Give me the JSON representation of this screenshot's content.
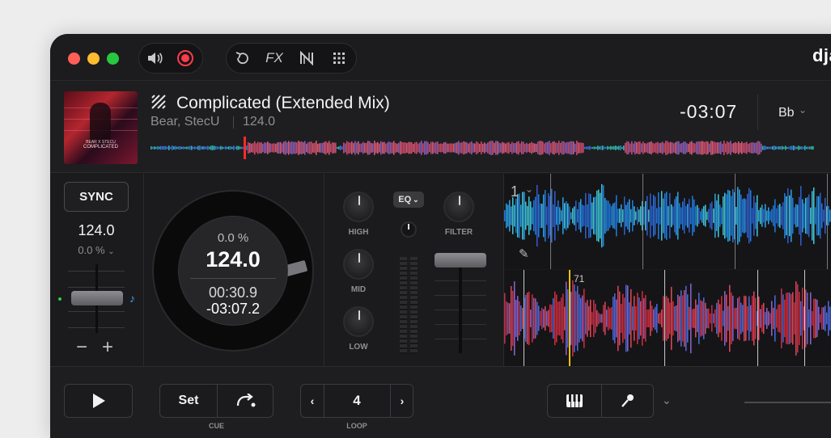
{
  "window": {
    "brand": "djay"
  },
  "titlebar": {
    "traffic_lights": [
      "#fe5f57",
      "#febc2e",
      "#28c840"
    ],
    "icons": [
      "speaker-icon",
      "record-icon",
      "loop-icon",
      "fx-icon",
      "neural-mix-icon",
      "grid-icon"
    ],
    "fx_label": "FX",
    "record_color": "#ff3b4a"
  },
  "track": {
    "title": "Complicated (Extended Mix)",
    "artist": "Bear, StecU",
    "bpm": "124.0",
    "remaining": "-03:07",
    "key": "Bb",
    "cover_artist": "BEAR X STECU",
    "cover_title": "COMPLICATED",
    "playhead_color": "#ff2a2a"
  },
  "deck": {
    "sync_label": "SYNC",
    "bpm": "124.0",
    "pitch": "0.0 %",
    "minus": "−",
    "plus": "+",
    "jog": {
      "pitch": "0.0 %",
      "bpm": "124.0",
      "elapsed": "00:30.9",
      "remaining": "-03:07.2"
    }
  },
  "mixer": {
    "high": "HIGH",
    "mid": "MID",
    "low": "LOW",
    "filter": "FILTER",
    "eq_label": "EQ"
  },
  "waveform": {
    "deck_number": "1",
    "beat_number": "71"
  },
  "bottom": {
    "set_label": "Set",
    "cue_caption": "CUE",
    "loop_value": "4",
    "loop_caption": "LOOP"
  }
}
